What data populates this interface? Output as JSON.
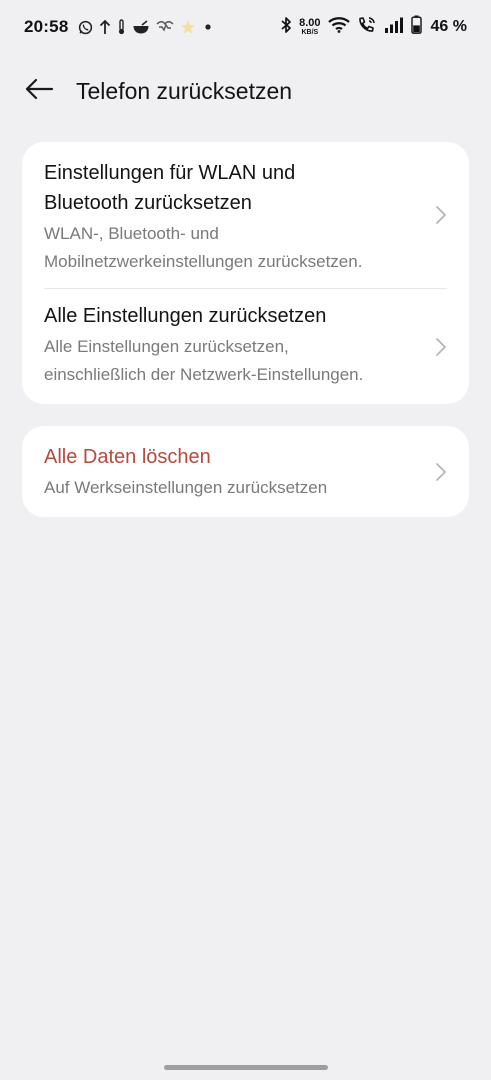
{
  "status_bar": {
    "time": "20:58",
    "left_icons": [
      "whatsapp-icon",
      "upload-arrow-icon",
      "thermometer-icon",
      "bowl-icon",
      "heart-rate-icon",
      "star-icon",
      "dot-icon"
    ],
    "net_speed_value": "8.00",
    "net_speed_unit": "KB/S",
    "right_icons": [
      "bluetooth-icon",
      "wifi-icon",
      "wifi-calling-icon",
      "signal-icon",
      "battery-icon"
    ],
    "battery_percent": "46 %",
    "battery_level": 0.46
  },
  "header": {
    "title": "Telefon zurücksetzen"
  },
  "reset_options": [
    {
      "title_line1": "Einstellungen für WLAN und",
      "title_line2": "Bluetooth zurücksetzen",
      "subtitle_line1": "WLAN-, Bluetooth- und",
      "subtitle_line2": "Mobilnetzwerkeinstellungen zurücksetzen."
    },
    {
      "title": "Alle Einstellungen zurücksetzen",
      "subtitle_line1": "Alle Einstellungen zurücksetzen,",
      "subtitle_line2": "einschließlich der Netzwerk-Einstellungen."
    }
  ],
  "erase": {
    "title": "Alle Daten löschen",
    "subtitle": "Auf Werkseinstellungen zurücksetzen"
  },
  "colors": {
    "background": "#f0f0f2",
    "card": "#ffffff",
    "danger": "#b64b3c",
    "secondary_text": "#7a7a7a"
  }
}
